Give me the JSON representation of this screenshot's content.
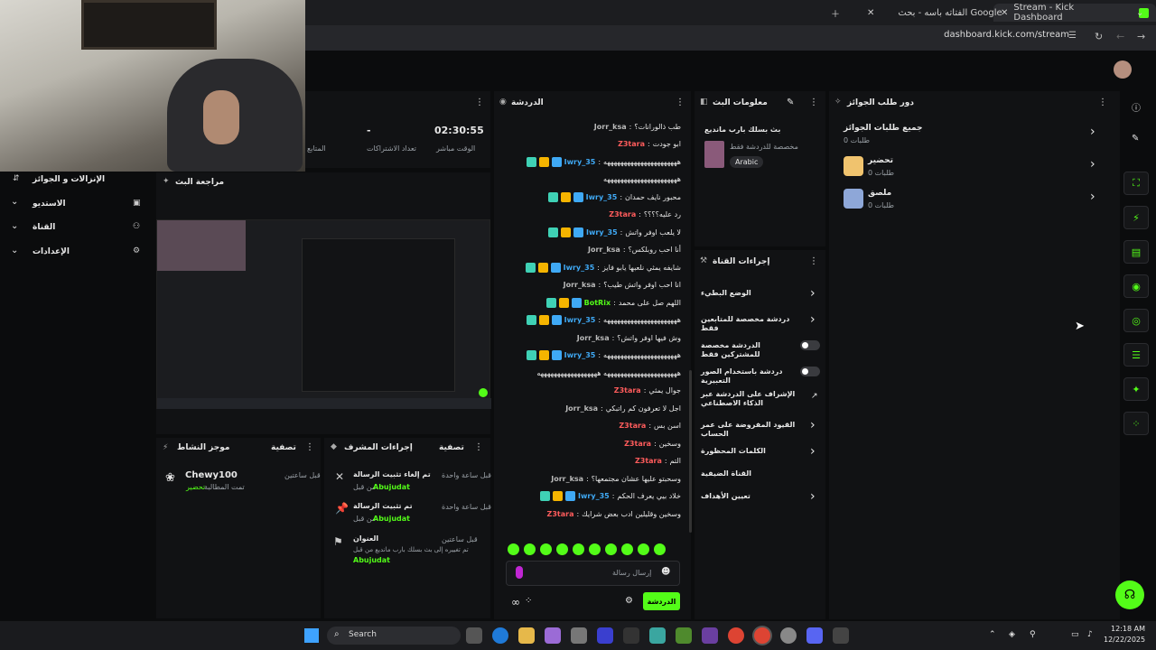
{
  "browser": {
    "tabs": [
      {
        "label": "Stream - Kick Dashboard"
      },
      {
        "label": "الفتاته باسه - بحث Google"
      }
    ],
    "url": "dashboard.kick.com/stream"
  },
  "stats": {
    "uptime_value": "02:30:55",
    "uptime_label": "الوقت مباشر",
    "subs_value": "-",
    "subs_label": "تعداد الاشتراكات",
    "viewers_label": "المتابع"
  },
  "left_nav": [
    {
      "label": "الإنزالات و الجوائز"
    },
    {
      "label": "الاستديو"
    },
    {
      "label": "القناة"
    },
    {
      "label": "الإعدادات"
    }
  ],
  "preview": {
    "title": "مراجعة البث"
  },
  "activity": {
    "title": "موجز النشاط",
    "filter": "تصفية",
    "item": {
      "name": "Chewy100",
      "time": "قبل ساعتين",
      "desc": "تمت المطالبة",
      "tag": "تحضير"
    }
  },
  "mod_actions": {
    "title": "إجراءات المشرف",
    "filter": "تصفية",
    "items": [
      {
        "title": "تم إلغاء تثبيت الرسالة",
        "time": "قبل ساعة واحدة",
        "by": "من قبل",
        "user": "Abujudat"
      },
      {
        "title": "تم تثبيت الرسالة",
        "time": "قبل ساعة واحدة",
        "by": "من قبل",
        "user": "Abujudat"
      },
      {
        "title": "العنوان",
        "time": "قبل ساعتين",
        "desc": "تم تغييره إلى بث بسلك بارب مانديع من قبل",
        "user": "Abujudat"
      }
    ]
  },
  "chat": {
    "title": "الدردشة",
    "messages": [
      {
        "user": "Jorr_ksa",
        "text": "طب ذالورانات؟",
        "color": "#b9b9b9"
      },
      {
        "user": "Z3tara",
        "text": "ابو جودت",
        "color": "#ff5c5c"
      },
      {
        "user": "Iwry_35",
        "text": "ههههههههههههههههههههههه",
        "color": "#3fa9f5",
        "badges": true
      },
      {
        "user": "",
        "text": "ههههههههههههههههههههههه",
        "color": "#3fa9f5"
      },
      {
        "user": "Iwry_35",
        "text": "محبور نايف حمدان",
        "color": "#3fa9f5",
        "badges": true
      },
      {
        "user": "Z3tara",
        "text": "رد عليه؟؟؟؟",
        "color": "#ff5c5c"
      },
      {
        "user": "Iwry_35",
        "text": "لا يلعب اوفر واتش",
        "color": "#3fa9f5",
        "badges": true
      },
      {
        "user": "Jorr_ksa",
        "text": "أنا احب روبلكس؟",
        "color": "#b9b9b9"
      },
      {
        "user": "Iwry_35",
        "text": "شايفه يمثي نلعبها يابو فايز",
        "color": "#3fa9f5",
        "badges": true
      },
      {
        "user": "Jorr_ksa",
        "text": "انا احب اوفر واتش طيب؟",
        "color": "#b9b9b9"
      },
      {
        "user": "BotRix",
        "text": "اللهم صل على محمد",
        "color": "#53fc18",
        "badges": true
      },
      {
        "user": "Iwry_35",
        "text": "ههههههههههههههههههههههه",
        "color": "#3fa9f5",
        "badges": true
      },
      {
        "user": "Jorr_ksa",
        "text": "وش فيها اوفر واتش؟",
        "color": "#b9b9b9"
      },
      {
        "user": "Iwry_35",
        "text": "ههههههههههههههههههههههه",
        "color": "#3fa9f5",
        "badges": true
      },
      {
        "user": "",
        "text": "ههههههههههههههههههههههه ههههههههههههههههههه",
        "color": "#3fa9f5"
      },
      {
        "user": "Z3tara",
        "text": "جوال يمثي",
        "color": "#ff5c5c"
      },
      {
        "user": "Jorr_ksa",
        "text": "اجل لا تعرفون كم راتبكي",
        "color": "#b9b9b9"
      },
      {
        "user": "Z3tara",
        "text": "اسن بس",
        "color": "#ff5c5c"
      },
      {
        "user": "Z3tara",
        "text": "وسخين",
        "color": "#ff5c5c"
      },
      {
        "user": "Z3tara",
        "text": "التم",
        "color": "#ff5c5c"
      },
      {
        "user": "Jorr_ksa",
        "text": "وسحبتو عليها عشان مجتمعها؟",
        "color": "#b9b9b9"
      },
      {
        "user": "Iwry_35",
        "text": "خلاد بيي يعرف الحكم",
        "color": "#3fa9f5",
        "badges": true
      },
      {
        "user": "Z3tara",
        "text": "وسخين وقليلين ادب بعض شرايك",
        "color": "#ff5c5c"
      }
    ],
    "input_placeholder": "إرسال رسالة",
    "send_label": "الدردشة"
  },
  "stream_info": {
    "title": "معلومات البث",
    "stream_title": "بث بسلك بارب مانديع",
    "category": "مخصصة للدردشة فقط",
    "language": "Arabic"
  },
  "channel_actions": {
    "title": "إجراءات القناة",
    "items": [
      {
        "label": "الوضع البطيء",
        "kind": "chev"
      },
      {
        "label": "دردشة مخصصة للمتابعين فقط",
        "kind": "chev"
      },
      {
        "label": "الدردشة مخصصة للمشتركين فقط",
        "kind": "toggle"
      },
      {
        "label": "دردشة باستخدام الصور التعبيرية",
        "kind": "toggle"
      },
      {
        "label": "الإشراف على الدردشة عبر الذكاء الاصطناعي",
        "kind": "ext"
      },
      {
        "label": "القيود المفروضة على عمر الحساب",
        "kind": "chev"
      },
      {
        "label": "الكلمات المحظورة",
        "kind": "chev"
      },
      {
        "label": "القناة الضيفية",
        "kind": "none"
      },
      {
        "label": "تعيين الأهداف",
        "kind": "chev"
      }
    ]
  },
  "rewards": {
    "title": "دور طلب الجوائز",
    "items": [
      {
        "label": "جميع طلبات الجوائز",
        "sub": "طلبات 0"
      },
      {
        "label": "تحضير",
        "sub": "طلبات 0"
      },
      {
        "label": "ملصق",
        "sub": "طلبات 0"
      }
    ]
  },
  "taskbar": {
    "search": "Search",
    "time": "12:18 AM",
    "date": "12/22/2025"
  },
  "colors": {
    "accent": "#53fc18",
    "panel": "#111214",
    "bg": "#0b0c0d"
  }
}
